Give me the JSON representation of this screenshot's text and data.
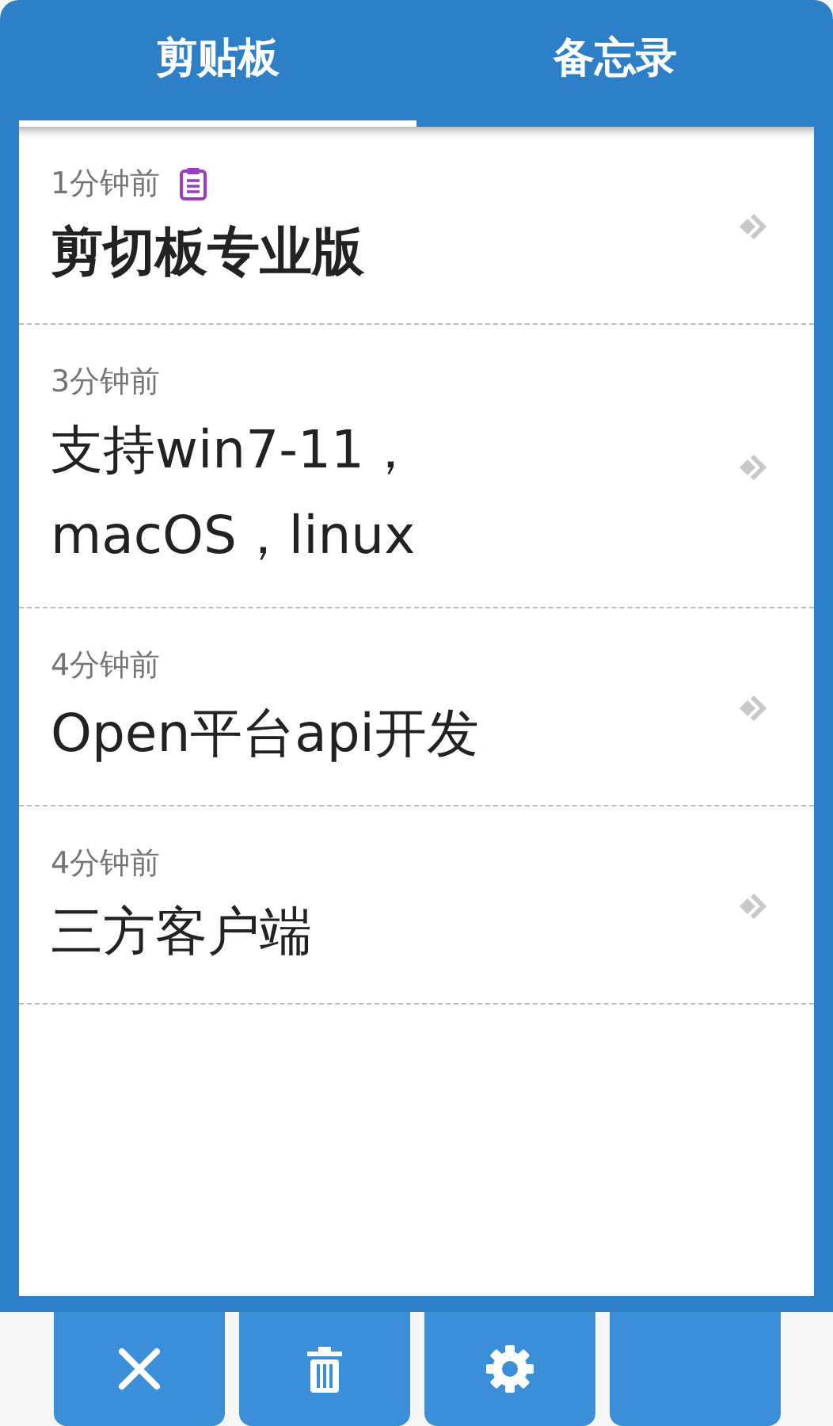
{
  "tabs": [
    {
      "label": "剪贴板",
      "selected": true
    },
    {
      "label": "备忘录",
      "selected": false
    }
  ],
  "items": [
    {
      "time": "1分钟前",
      "clip_icon": true,
      "bold": true,
      "title": "剪切板专业版"
    },
    {
      "time": "3分钟前",
      "clip_icon": false,
      "bold": false,
      "title": "支持win7-11，macOS，linux"
    },
    {
      "time": "4分钟前",
      "clip_icon": false,
      "bold": false,
      "title": "Open平台api开发"
    },
    {
      "time": "4分钟前",
      "clip_icon": false,
      "bold": false,
      "title": "三方客户端"
    }
  ],
  "buttons": [
    {
      "kind": "close"
    },
    {
      "kind": "delete"
    },
    {
      "kind": "settings"
    },
    {
      "kind": "hidden"
    }
  ]
}
